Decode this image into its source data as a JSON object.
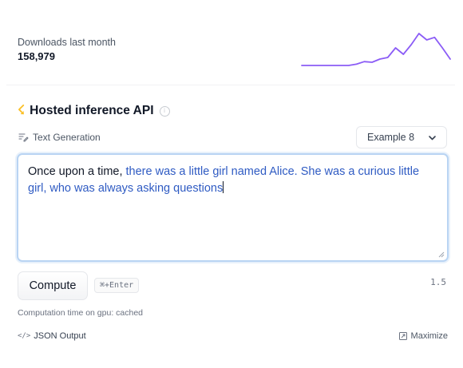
{
  "downloads": {
    "label": "Downloads last month",
    "count": "158,979",
    "trend": [
      0,
      0,
      0,
      0,
      0,
      0,
      0,
      0.04,
      0.12,
      0.1,
      0.2,
      0.25,
      0.55,
      0.35,
      0.65,
      1.0,
      0.8,
      0.88,
      0.55,
      0.2
    ],
    "line_color": "#8b5cf6"
  },
  "api": {
    "title": "Hosted inference API",
    "info_glyph": "i",
    "task_label": "Text Generation",
    "example_selected": "Example 8",
    "prompt_text": "Once upon a time, ",
    "generated_text": "there was a little girl named Alice. She was a curious little girl, who was always asking questions",
    "compute_label": "Compute",
    "shortcut": "⌘+Enter",
    "version": "1.5",
    "computation_time": "Computation time on gpu: cached",
    "json_output_label": "JSON Output",
    "json_icon": "</>",
    "maximize_label": "Maximize",
    "accent_color": "#fbbf24",
    "generated_color": "#2f5bc3"
  }
}
